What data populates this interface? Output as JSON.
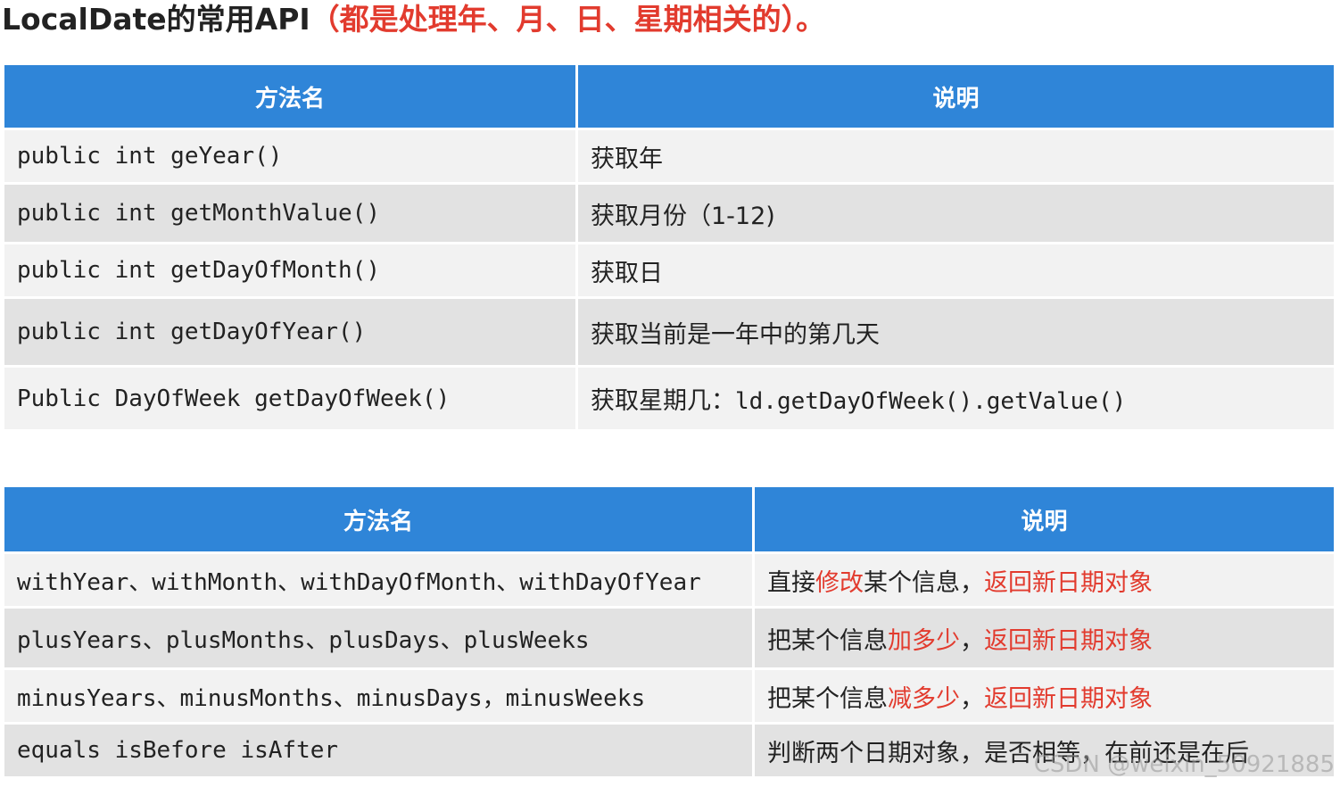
{
  "title": {
    "main": "LocalDate的常用API",
    "sub": "（都是处理年、月、日、星期相关的）。"
  },
  "table1": {
    "headers": [
      "方法名",
      "说明"
    ],
    "rows": [
      {
        "method": "public int geYear()",
        "desc": "获取年"
      },
      {
        "method": "public int getMonthValue()",
        "desc": "获取月份（1-12)"
      },
      {
        "method": "public int getDayOfMonth()",
        "desc": "获取日"
      },
      {
        "method": "public int getDayOfYear()",
        "desc": "获取当前是一年中的第几天"
      },
      {
        "method": "Public DayOfWeek getDayOfWeek()",
        "desc": "获取星期几：",
        "desc_code": "ld.getDayOfWeek().getValue()"
      }
    ]
  },
  "table2": {
    "headers": [
      "方法名",
      "说明"
    ],
    "rows": [
      {
        "method": "withYear、withMonth、withDayOfMonth、withDayOfYear",
        "desc_a": "直接",
        "desc_b": "修改",
        "desc_c": "某个信息，",
        "desc_d": "返回新日期对象"
      },
      {
        "method": "plusYears、plusMonths、plusDays、plusWeeks",
        "desc_a": "把某个信息",
        "desc_b": "加多少",
        "desc_c": "，",
        "desc_d": "返回新日期对象"
      },
      {
        "method": "minusYears、minusMonths、minusDays，minusWeeks",
        "desc_a": "把某个信息",
        "desc_b": "减多少",
        "desc_c": "，",
        "desc_d": "返回新日期对象"
      },
      {
        "method": "equals isBefore isAfter",
        "desc_a": "判断两个日期对象，是否相等，在前还是在后"
      }
    ]
  },
  "watermark": "CSDN @weixin_50921885",
  "colors": {
    "header_bg": "#2f85d8",
    "row_light": "#f2f2f2",
    "row_dark": "#e2e2e2",
    "accent_red": "#e23b2e"
  }
}
